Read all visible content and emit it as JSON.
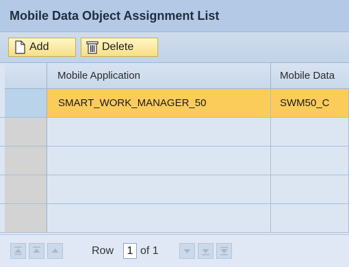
{
  "title": "Mobile Data Object Assignment List",
  "toolbar": {
    "add_label": "Add",
    "delete_label": "Delete"
  },
  "table": {
    "columns": [
      "Mobile Application",
      "Mobile Data"
    ],
    "rows": [
      [
        "SMART_WORK_MANAGER_50",
        "SWM50_C"
      ],
      [
        "",
        ""
      ],
      [
        "",
        ""
      ],
      [
        "",
        ""
      ],
      [
        "",
        ""
      ]
    ]
  },
  "footer": {
    "row_label": "Row",
    "current_row": "1",
    "of_label": "of 1"
  },
  "colors": {
    "title_bg": "#b3c9e6",
    "selected_row": "#fbcc5a",
    "button_bg": "#f6df86"
  }
}
